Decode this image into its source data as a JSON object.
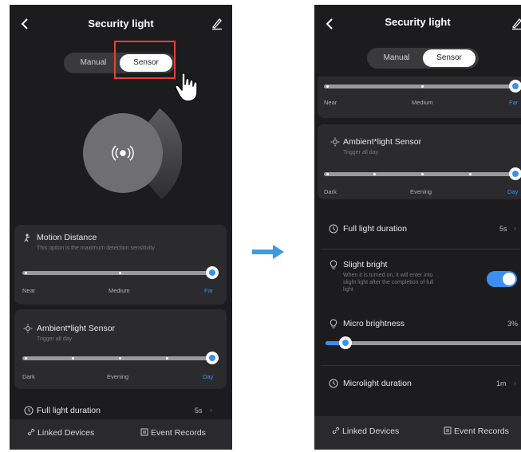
{
  "screen_left": {
    "title": "Security light",
    "mode_toggle": {
      "manual": "Manual",
      "sensor": "Sensor",
      "selected": "Sensor"
    },
    "motion_distance": {
      "title": "Motion Distance",
      "subtitle": "This option is the maximum detection sensitivity",
      "labels": [
        "Near",
        "Medium",
        "Far"
      ],
      "selected": "Far"
    },
    "ambient": {
      "title": "Ambient*light Sensor",
      "subtitle": "Trigger all day",
      "labels": [
        "Dark",
        "Evening",
        "Day"
      ],
      "selected": "Day"
    },
    "full_light": {
      "title": "Full light duration",
      "value": "5s"
    },
    "bottom": {
      "linked": "Linked Devices",
      "records": "Event Records"
    }
  },
  "screen_right": {
    "title": "Security light",
    "mode_toggle": {
      "manual": "Manual",
      "sensor": "Sensor",
      "selected": "Sensor"
    },
    "distance_labels": [
      "Near",
      "Medium",
      "Far"
    ],
    "distance_selected": "Far",
    "ambient": {
      "title": "Ambient*light Sensor",
      "subtitle": "Trigger all day",
      "labels": [
        "Dark",
        "Evening",
        "Day"
      ],
      "selected": "Day"
    },
    "full_light": {
      "title": "Full light duration",
      "value": "5s"
    },
    "slight_bright": {
      "title": "Slight bright",
      "line1": "When it is turned on, it will enter into",
      "line2": "slight light after the completion of full",
      "line3": "light",
      "enabled": true
    },
    "micro_brightness": {
      "title": "Micro brightness",
      "value": "3%",
      "level_percent": 3
    },
    "microlight_duration": {
      "title": "Microlight duration",
      "value": "1m"
    },
    "bottom": {
      "linked": "Linked Devices",
      "records": "Event Records"
    }
  },
  "colors": {
    "accent": "#3b8ff0",
    "background": "#1c1c1e",
    "card": "#2b2b2e",
    "highlight": "#e8412e",
    "arrow": "#3b9be0"
  },
  "icons": [
    "back-chevron-icon",
    "edit-pencil-icon",
    "motion-sensor-icon",
    "sun-icon",
    "clock-icon",
    "bulb-icon",
    "link-icon",
    "record-icon",
    "right-arrow-icon",
    "hand-pointer-icon"
  ]
}
